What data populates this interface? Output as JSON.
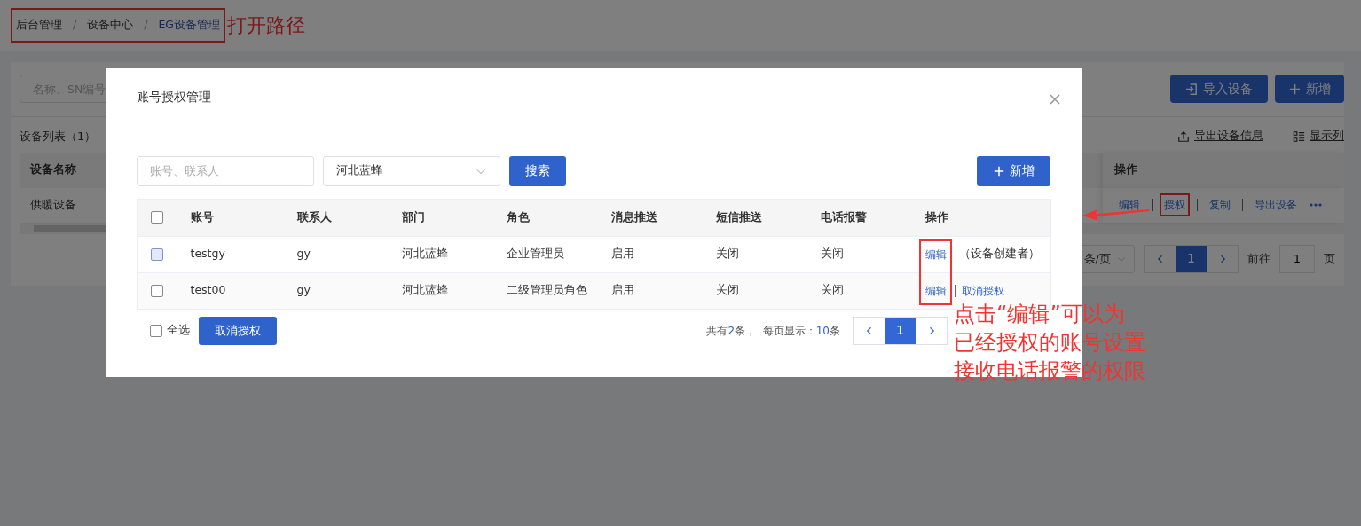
{
  "breadcrumb": {
    "annotated": true,
    "separator": "/",
    "items": [
      {
        "label": "后台管理",
        "current": false
      },
      {
        "label": "设备中心",
        "current": false
      },
      {
        "label": "EG设备管理",
        "current": true
      }
    ]
  },
  "page": {
    "search": {
      "placeholder": "名称、SN编号"
    },
    "buttons": [
      {
        "label": "导入设备"
      },
      {
        "label": "新增"
      }
    ],
    "list_title": "设备列表（1）",
    "tools": [
      {
        "label": "导出设备信息"
      },
      {
        "label": "显示列"
      }
    ],
    "table": {
      "columns": [
        "设备名称",
        "操作"
      ],
      "rows": [
        {
          "name": "供暖设备",
          "actions": [
            {
              "label": "编辑",
              "highlighted": false
            },
            {
              "label": "授权",
              "highlighted": true
            },
            {
              "label": "复制",
              "highlighted": false
            },
            {
              "label": "导出设备",
              "highlighted": false
            }
          ]
        }
      ]
    },
    "pagination": {
      "page_size": "条/页",
      "pages": [
        {
          "label": "1",
          "selected": true
        }
      ],
      "jump_label": "前往",
      "jump_value": "1",
      "jump_suffix": "页"
    }
  },
  "modal": {
    "title": "账号授权管理",
    "search": {
      "placeholder": "账号、联系人"
    },
    "department_select": {
      "value": "河北蓝蜂"
    },
    "search_button": "搜索",
    "add_button": "新增",
    "table": {
      "header_checked": false,
      "columns": [
        "账号",
        "联系人",
        "部门",
        "角色",
        "消息推送",
        "短信推送",
        "电话报警",
        "操作"
      ],
      "rows": [
        {
          "checked": false,
          "hovered": true,
          "cells": [
            "testgy",
            "gy",
            "河北蓝蜂",
            "企业管理员",
            "启用",
            "关闭",
            "关闭"
          ],
          "actions": [
            "编辑"
          ],
          "note": "（设备创建者）"
        },
        {
          "checked": false,
          "hovered": false,
          "cells": [
            "test00",
            "gy",
            "河北蓝蜂",
            "二级管理员角色",
            "启用",
            "关闭",
            "关闭"
          ],
          "actions": [
            "编辑",
            "取消授权"
          ]
        }
      ]
    },
    "footer": {
      "select_all": {
        "label": "全选",
        "checked": false
      },
      "cancel_button": "取消授权",
      "summary": [
        {
          "text": "共有",
          "accent": false
        },
        {
          "text": "2",
          "accent": true
        },
        {
          "text": "条，  每页显示：",
          "accent": false
        },
        {
          "text": "10",
          "accent": true
        },
        {
          "text": "条",
          "accent": false
        }
      ],
      "pages": [
        {
          "label": "1",
          "selected": true
        }
      ]
    }
  },
  "annotations": {
    "path_note": "打开路径",
    "edit_note": [
      "点击“编辑”可以为",
      "已经授权的账号设置",
      "接收电话报警的权限"
    ]
  }
}
